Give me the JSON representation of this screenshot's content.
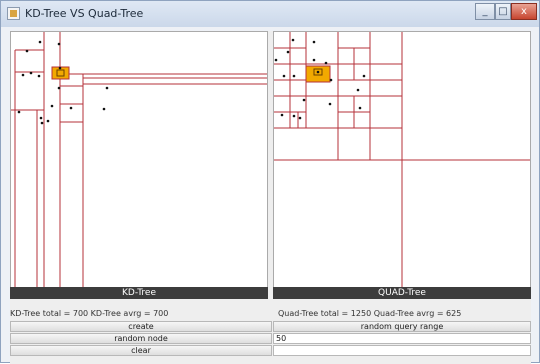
{
  "window": {
    "title": "KD-Tree VS Quad-Tree",
    "minimize_glyph": "_",
    "maximize_glyph": "□",
    "close_glyph": "x"
  },
  "colors": {
    "partition_line": "#b5313a",
    "query_range": "#f2a900",
    "node_point": "#111111",
    "label_bar": "#3c3c3c"
  },
  "kd_panel": {
    "label": "KD-Tree",
    "stats": "KD-Tree total = 700 KD-Tree avrg = 700"
  },
  "quad_panel": {
    "label": "QUAD-Tree",
    "stats": "Quad-Tree total = 1250 Quad-Tree avrg = 625"
  },
  "controls": {
    "create_label": "create",
    "random_query_label": "random query range",
    "random_node_label": "random node",
    "node_count_value": "50",
    "clear_label": "clear"
  }
}
